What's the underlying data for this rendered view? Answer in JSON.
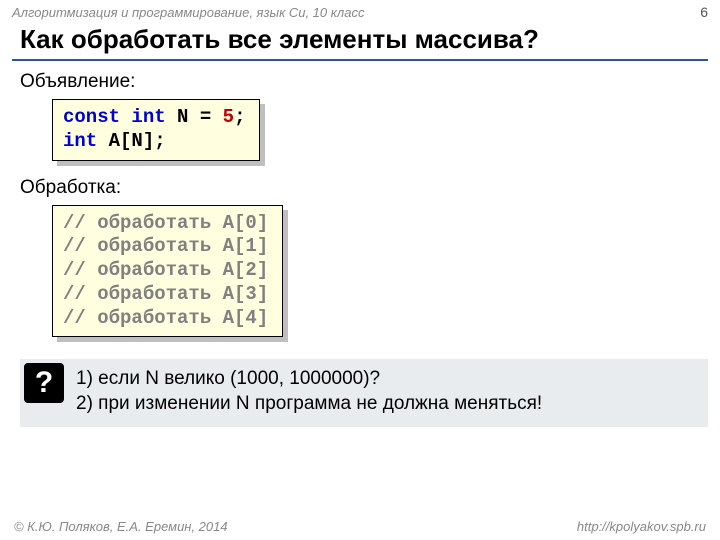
{
  "header": {
    "course": "Алгоритмизация и программирование, язык Си, 10 класс",
    "page": "6"
  },
  "title": "Как обработать все элементы массива?",
  "sections": {
    "decl_label": "Объявление:",
    "proc_label": "Обработка:"
  },
  "code_decl": {
    "l1_kw": "const int",
    "l1_name": " N",
    "l1_eq": " = ",
    "l1_val": "5",
    "l1_end": ";",
    "l2_kw": "int",
    "l2_rest": " A[N];"
  },
  "code_proc": {
    "lines": [
      "// обработать A[0]",
      "// обработать A[1]",
      "// обработать A[2]",
      "// обработать A[3]",
      "// обработать A[4]"
    ]
  },
  "question": {
    "badge": "?",
    "line1": "1) если N велико (1000, 1000000)?",
    "line2": "2) при изменении N программа не должна меняться!"
  },
  "footer": {
    "left": "© К.Ю. Поляков, Е.А. Еремин, 2014",
    "right": "http://kpolyakov.spb.ru"
  }
}
